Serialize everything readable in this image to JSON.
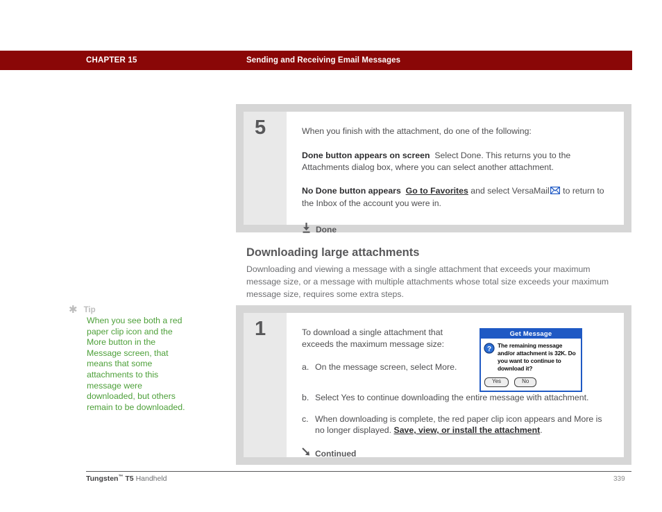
{
  "header": {
    "chapter": "CHAPTER 15",
    "title": "Sending and Receiving Email Messages",
    "bar_color": "#8a0707"
  },
  "step5": {
    "number": "5",
    "intro": "When you finish with the attachment, do one of the following:",
    "option1_label": "Done button appears on screen",
    "option1_text": "Select Done. This returns you to the Attachments dialog box, where you can select another attachment.",
    "option2_label": "No Done button appears",
    "option2_link": "Go to Favorites",
    "option2_text_a": "and select VersaMail",
    "option2_text_b": "to return to the Inbox of the account you were in.",
    "done_label": "Done",
    "done_icon": "download-arrow-icon",
    "envelope_icon": "versamail-envelope-icon"
  },
  "section": {
    "heading": "Downloading large attachments",
    "paragraph": "Downloading and viewing a message with a single attachment that exceeds your maximum message size, or a message with multiple attachments whose total size exceeds your maximum message size, requires some extra steps."
  },
  "tip": {
    "icon": "asterisk-icon",
    "label": "Tip",
    "text": "When you see both a red paper clip icon and the More button in the Message screen, that means that some attachments to this message were downloaded, but others remain to be downloaded.",
    "text_color": "#4c9f38"
  },
  "step1": {
    "number": "1",
    "intro": "To download a single attachment that exceeds the maximum message size:",
    "items": [
      {
        "marker": "a.",
        "text": "On the message screen, select More."
      },
      {
        "marker": "b.",
        "text": "Select Yes to continue downloading the entire message with attachment."
      }
    ],
    "item_c": {
      "marker": "c.",
      "text_before": "When downloading is complete, the red paper clip icon appears and More is no longer displayed.",
      "link": "Save, view, or install the attachment",
      "text_after": "."
    },
    "continued_label": "Continued",
    "continued_icon": "arrow-down-right-icon"
  },
  "dialog": {
    "title": "Get Message",
    "icon": "question-mark-icon",
    "message": "The remaining message and/or attachment is 32K. Do you want to continue to download it?",
    "buttons": [
      {
        "label": "Yes"
      },
      {
        "label": "No"
      }
    ],
    "accent_color": "#1f59c4"
  },
  "footer": {
    "product_bold": "Tungsten",
    "product_tm": "™",
    "product_model": " T5 ",
    "product_rest": "Handheld",
    "page_number": "339"
  }
}
